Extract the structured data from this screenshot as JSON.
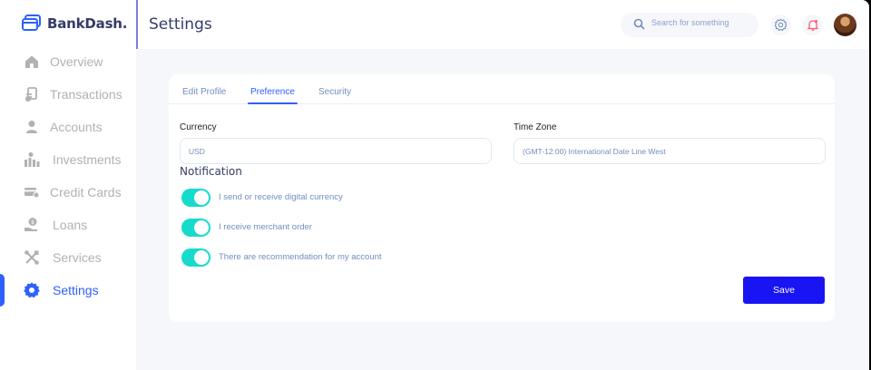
{
  "app": {
    "name": "BankDash."
  },
  "sidebar": {
    "items": [
      {
        "label": "Overview",
        "icon": "home-icon"
      },
      {
        "label": "Transactions",
        "icon": "transfer-icon"
      },
      {
        "label": "Accounts",
        "icon": "user-icon"
      },
      {
        "label": "Investments",
        "icon": "economic-investment-icon"
      },
      {
        "label": "Credit Cards",
        "icon": "credit-card-icon"
      },
      {
        "label": "Loans",
        "icon": "loan-icon"
      },
      {
        "label": "Services",
        "icon": "service-icon"
      },
      {
        "label": "Settings",
        "icon": "settings-icon",
        "active": true
      }
    ]
  },
  "header": {
    "title": "Settings",
    "search_placeholder": "Search for something"
  },
  "settings": {
    "tabs": [
      {
        "label": "Edit Profile"
      },
      {
        "label": "Preference",
        "active": true
      },
      {
        "label": "Security"
      }
    ],
    "currency": {
      "label": "Currency",
      "value": "USD"
    },
    "timezone": {
      "label": "Time Zone",
      "value": "(GMT-12:00) International Date Line West"
    },
    "notification": {
      "title": "Notification",
      "options": [
        {
          "label": "I send or receive digital currency",
          "on": true
        },
        {
          "label": "I receive merchant order",
          "on": true
        },
        {
          "label": "There are recommendation for my account",
          "on": true
        }
      ]
    },
    "save_label": "Save"
  },
  "colors": {
    "accent": "#2d60ff",
    "toggle_on": "#16dbcc",
    "save_button": "#1814f3",
    "muted_text": "#718ebf",
    "nav_inactive": "#b1b1b1"
  }
}
